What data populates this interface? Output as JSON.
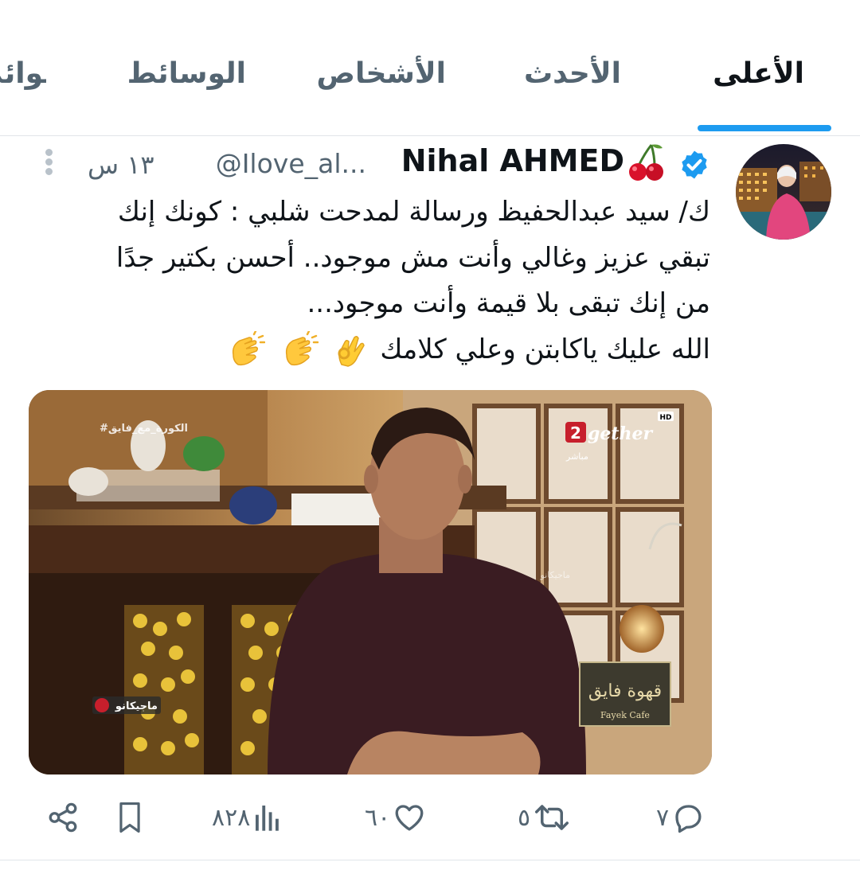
{
  "tabs": [
    {
      "label": "الأعلى",
      "active": true
    },
    {
      "label": "الأحدث",
      "active": false
    },
    {
      "label": "الأشخاص",
      "active": false
    },
    {
      "label": "الوسائط",
      "active": false
    },
    {
      "label": "القوائم",
      "active": false
    }
  ],
  "tweet": {
    "display_name": "Nihal AHMED",
    "handle": "@Ilove_al...",
    "time": "١٣ س",
    "text_lines": [
      "ك/ سيد عبدالحفيظ ورسالة لمدحت شلبي : كونك إنك",
      "تبقي عزيز وغالي وأنت مش موجود.. أحسن بكتير جدًا",
      "من إنك تبقى بلا قيمة وأنت موجود...",
      "الله عليك ياكابتن وعلي كلامك"
    ],
    "media": {
      "tv_hashtag": "#الكورة_مع_فايق",
      "channel": "gether",
      "live_label": "مباشر",
      "hd_label": "HD",
      "program_title": "قهوة فايق",
      "program_subtitle": "Fayek Cafe",
      "sponsor": "ماجيكانو",
      "watermark": "ماجيكانو"
    }
  },
  "actions": {
    "replies": "٧",
    "retweets": "٥",
    "likes": "٦٠",
    "views": "٨٢٨"
  },
  "colors": {
    "accent": "#1d9bf0",
    "muted": "#536471"
  }
}
